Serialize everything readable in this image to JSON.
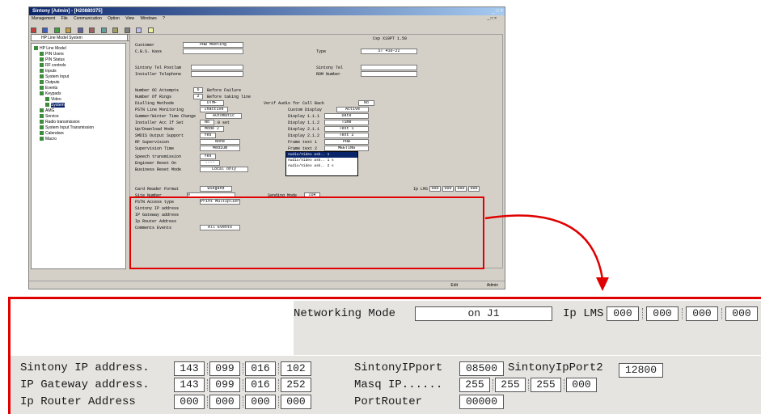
{
  "window": {
    "title": "Sintony [Admin] - [H20880375]",
    "title_buttons": "_ □ ×",
    "menu": [
      "Management",
      "File",
      "Communication",
      "Option",
      "View",
      "Windows",
      "?"
    ],
    "mdi_buttons": "_ □ ×",
    "system_selector": "HP Line Model System",
    "tree": [
      "HP Line Model",
      "PIN Users",
      "PIN Status",
      "RF controls",
      "Inputs",
      "System Input",
      "Outputs",
      "Events",
      "Keypads",
      "Video",
      "System",
      "AMG",
      "Service",
      "Radio transmission",
      "System Input Transmission",
      "Calendars",
      "Macro"
    ],
    "status": {
      "left": "Edit",
      "right": "Admin"
    }
  },
  "form": {
    "top_right": "Csp X10PT 1.50",
    "customer_label": "Customer",
    "customer_value": "PHB Meeting",
    "cbs_label": "C.B.S. Kass",
    "type_label": "Type",
    "type_value": "ST 410-22",
    "sintony_tel_label": "Sintony Tel Postlam",
    "sintony_tel2_label": "Sintony Tel",
    "installer_tel_label": "Installer Telephone",
    "rom_label": "ROM Number",
    "attempts_label": "Number OC Attempts",
    "attempts_value": "6",
    "attempts_desc": "Before Failure",
    "rings_label": "Number Of Rings",
    "rings_value": "2",
    "rings_desc": "Before taking line",
    "dial_method_label": "Dialling Methode",
    "dial_method_value": "DTMF",
    "verif_label": "Verif Audio for Call Back",
    "verif_value": "No",
    "pstn_label": "PSTN Line Monitoring",
    "pstn_value": "Inactive",
    "custom_display_label": "Custom Display",
    "custom_display_value": "Active",
    "summer_label": "Summer/Winter Time Change",
    "summer_value": "Automatic",
    "display_lines": [
      {
        "label": "Display 1.1.1",
        "value": "Date"
      },
      {
        "label": "Display 1.1.2",
        "value": "Time"
      },
      {
        "label": "Display 2.1.1",
        "value": "Text 1"
      },
      {
        "label": "Display 2.1.2",
        "value": "Text 2"
      }
    ],
    "installer_acc_label": "Installer Acc If Set",
    "installer_acc_value": "No",
    "installer_acc_unit": "0 set",
    "updown_label": "Up/Download Mode",
    "updown_value": "Mode 2",
    "smdis_label": "SMDIS Output Support",
    "smdis_value": "Yes",
    "rf_sup_label": "RF Supervision",
    "rf_sup_value": "None",
    "supervision_label": "Supervision Time",
    "supervision_value": "Medium",
    "speech_label": "Speech transmission",
    "speech_value": "Yes",
    "engineer_label": "Engineer Reset On",
    "engineer_value": "----",
    "business_label": "Business Reset Mode",
    "business_value": "Local only",
    "frame_text1_label": "Frame text 1",
    "frame_text1_value": "PHB",
    "frame_text2_label": "Frame text 2",
    "frame_text2_value": "MEETING",
    "dropdown_items": [
      "Audio/Video ask.. 1",
      "Audio/Video ask.. 1 s",
      "Audio/Video ask.. 2 s"
    ],
    "card_reader_label": "Card Reader Format",
    "card_reader_value": "Wiegand",
    "site_label": "Site Number",
    "site_value": "0",
    "pstn_access_label": "PSTN Access type",
    "pstn_access_value": "Print Multiplier",
    "sintony_ip_label_small": "Sintony IP address",
    "ip_gateway_label_small": "IP Gateway address",
    "ip_router_label_small": "Ip Router Address",
    "comments_label": "Comments Events",
    "comments_value": "All Events",
    "sending_mode_label": "Sending Mode",
    "sending_mode_value": "IUR",
    "ip_lms_small": "Ip LMS"
  },
  "zoom": {
    "networking_mode_label": "Networking Mode",
    "networking_mode_value": "on J1",
    "ip_lms_label": "Ip LMS",
    "ip_lms": [
      "000",
      "000",
      "000",
      "000"
    ],
    "sintony_ip_label": "Sintony IP address.",
    "sintony_ip": [
      "143",
      "099",
      "016",
      "102"
    ],
    "ip_gateway_label": "IP Gateway address.",
    "ip_gateway": [
      "143",
      "099",
      "016",
      "252"
    ],
    "ip_router_label": "Ip Router Address",
    "ip_router": [
      "000",
      "000",
      "000",
      "000"
    ],
    "sintony_ipport_label": "SintonyIPport",
    "sintony_ipport": "08500",
    "sintony_ipport2_label": "SintonyIpPort2",
    "sintony_ipport2": "12800",
    "masq_ip_label": "Masq IP......",
    "masq_ip": [
      "255",
      "255",
      "255",
      "000"
    ],
    "port_router_label": "PortRouter",
    "port_router": "00000"
  },
  "colors": {
    "highlight": "#e00000",
    "title_bar": "#0a246a",
    "window_face": "#d4d0c8"
  }
}
